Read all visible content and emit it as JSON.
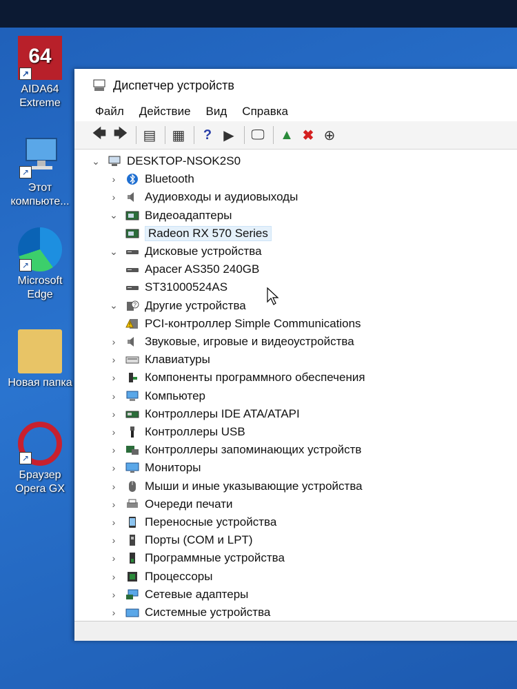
{
  "desktop": {
    "icons": [
      {
        "label1": "AIDA64",
        "label2": "Extreme",
        "glyph": "64"
      },
      {
        "label1": "Этот",
        "label2": "компьюте..."
      },
      {
        "label1": "Microsoft",
        "label2": "Edge"
      },
      {
        "label1": "Новая папка",
        "label2": ""
      },
      {
        "label1": "Браузер",
        "label2": "Opera GX"
      }
    ]
  },
  "window": {
    "title": "Диспетчер устройств",
    "menu": [
      "Файл",
      "Действие",
      "Вид",
      "Справка"
    ]
  },
  "tree": {
    "root": "DESKTOP-NSOK2S0",
    "items": [
      {
        "label": "Bluetooth",
        "icon": "bluetooth-icon",
        "expanded": false
      },
      {
        "label": "Аудиовходы и аудиовыходы",
        "icon": "speaker-icon",
        "expanded": false
      },
      {
        "label": "Видеоадаптеры",
        "icon": "display-adapter-icon",
        "expanded": true
      },
      {
        "label": "Radeon RX 570 Series",
        "icon": "display-adapter-icon",
        "child": true
      },
      {
        "label": "Дисковые устройства",
        "icon": "disk-drive-icon",
        "expanded": true
      },
      {
        "label": "Apacer AS350 240GB",
        "icon": "disk-drive-icon",
        "child": true
      },
      {
        "label": "ST31000524AS",
        "icon": "disk-drive-icon",
        "child": true
      },
      {
        "label": "Другие устройства",
        "icon": "unknown-device-icon",
        "expanded": true
      },
      {
        "label": "PCI-контроллер Simple Communications",
        "icon": "warning-device-icon",
        "child": true
      },
      {
        "label": "Звуковые, игровые и видеоустройства",
        "icon": "speaker-icon",
        "expanded": false
      },
      {
        "label": "Клавиатуры",
        "icon": "keyboard-icon",
        "expanded": false
      },
      {
        "label": "Компоненты программного обеспечения",
        "icon": "software-component-icon",
        "expanded": false
      },
      {
        "label": "Компьютер",
        "icon": "computer-icon",
        "expanded": false
      },
      {
        "label": "Контроллеры IDE ATA/ATAPI",
        "icon": "ide-controller-icon",
        "expanded": false
      },
      {
        "label": "Контроллеры USB",
        "icon": "usb-icon",
        "expanded": false
      },
      {
        "label": "Контроллеры запоминающих устройств",
        "icon": "storage-controller-icon",
        "expanded": false
      },
      {
        "label": "Мониторы",
        "icon": "monitor-icon",
        "expanded": false
      },
      {
        "label": "Мыши и иные указывающие устройства",
        "icon": "mouse-icon",
        "expanded": false
      },
      {
        "label": "Очереди печати",
        "icon": "printer-icon",
        "expanded": false
      },
      {
        "label": "Переносные устройства",
        "icon": "portable-device-icon",
        "expanded": false
      },
      {
        "label": "Порты (COM и LPT)",
        "icon": "port-icon",
        "expanded": false
      },
      {
        "label": "Программные устройства",
        "icon": "software-device-icon",
        "expanded": false
      },
      {
        "label": "Процессоры",
        "icon": "processor-icon",
        "expanded": false
      },
      {
        "label": "Сетевые адаптеры",
        "icon": "network-adapter-icon",
        "expanded": false
      },
      {
        "label": "Системные устройства",
        "icon": "system-device-icon",
        "expanded": false
      }
    ]
  }
}
